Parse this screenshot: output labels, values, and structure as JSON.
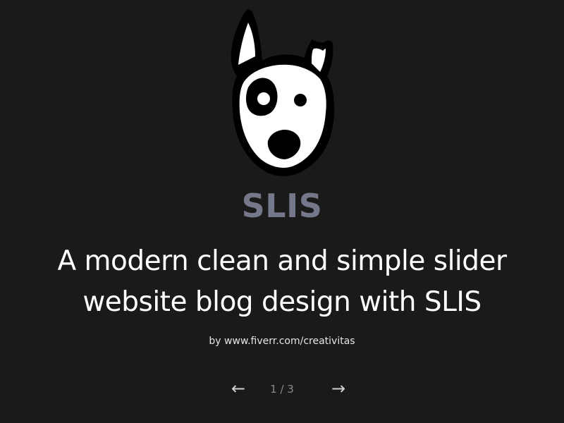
{
  "brand": {
    "name": "SLIS",
    "logo_icon": "dog-head-icon",
    "accent_color": "#74788a"
  },
  "slide": {
    "headline": "A modern clean and simple slider website blog design with SLIS",
    "byline": "by www.fiverr.com/creativitas"
  },
  "pager": {
    "prev_icon": "←",
    "next_icon": "→",
    "current": 1,
    "total": 3,
    "label": "1 / 3"
  },
  "colors": {
    "background": "#1b1a1b",
    "text": "#ffffff"
  }
}
